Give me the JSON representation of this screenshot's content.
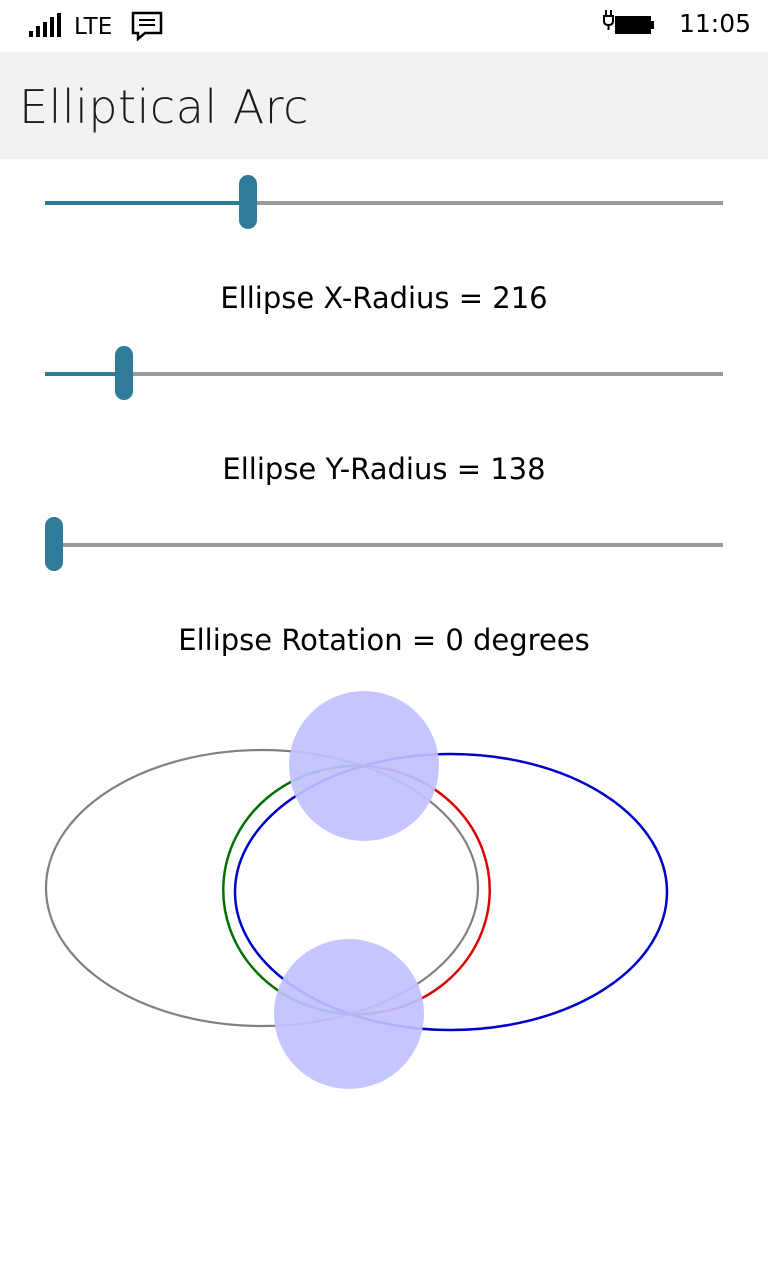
{
  "status_bar": {
    "network": "LTE",
    "time": "11:05",
    "icons": [
      "signal-bars-icon",
      "message-icon",
      "battery-charging-icon"
    ]
  },
  "header": {
    "title": "Elliptical Arc"
  },
  "sliders": [
    {
      "name": "unlabeled",
      "label": "",
      "fraction": 0.294
    },
    {
      "name": "x-radius",
      "label": "Ellipse X-Radius = 216",
      "fraction": 0.106
    },
    {
      "name": "y-radius",
      "label": "Ellipse Y-Radius = 138",
      "fraction": 0.0
    }
  ],
  "rotation_label": "Ellipse Rotation = 0 degrees",
  "colors": {
    "accent": "#2f7b98",
    "track": "#999999",
    "ellipse_1": "#808080",
    "ellipse_2": "#0000cc",
    "arc_left": "#007000",
    "arc_right": "#dd0000",
    "point_fill": "#c0c0ff"
  }
}
